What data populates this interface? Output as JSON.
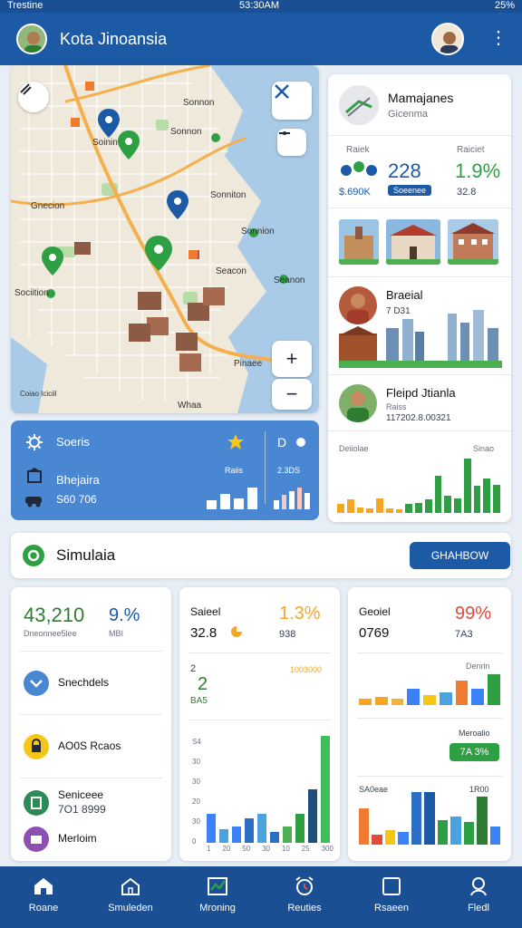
{
  "status": {
    "left": "Trestine",
    "time": "53:30AM",
    "battery": "25%"
  },
  "header": {
    "title": "Kota Jinoansia"
  },
  "map": {
    "labels": [
      "Soinin",
      "Sonnon",
      "Gnecion",
      "Sonnon",
      "Sonniton",
      "Sonnion",
      "Seacon",
      "Seanon",
      "Sociition",
      "Coiao Iciciil",
      "Pinaee",
      "Whaa"
    ],
    "zoom_in": "+",
    "zoom_out": "−"
  },
  "right_panel": {
    "profile": {
      "name": "Mamajanes",
      "subtitle": "Gicenma"
    },
    "stats": {
      "label_left": "Raiek",
      "label_right": "Raiciet",
      "value_main": "228",
      "value_pct": "1.9%",
      "sub_left": "$.690K",
      "badge": "Soeenee",
      "sub_right": "32.8"
    },
    "agent1": {
      "name": "Braeial",
      "sub": "7 D31"
    },
    "agent2": {
      "name": "Fleipd Jtianla",
      "sub1": "Raiss",
      "sub2": "117202.8.00321"
    },
    "chart": {
      "label_left": "Deiiolae",
      "label_right": "Sinao",
      "values": [
        14,
        22,
        9,
        7,
        24,
        8,
        6,
        14,
        16,
        22,
        60,
        28,
        24,
        88,
        44,
        56,
        46
      ]
    }
  },
  "blue_panel": {
    "row1_label": "Soeris",
    "row2_label": "Bhejaira",
    "row3_label": "S60 706",
    "right_top": "Raiis",
    "right_top2": "2.3DS",
    "bars_left": [
      8,
      14,
      10,
      20
    ],
    "bars_right": [
      10,
      16,
      20,
      24,
      18
    ]
  },
  "simulation": {
    "title": "Simulaia",
    "button": "GHAHBOW"
  },
  "card1": {
    "value": "43,210",
    "pct": "9.%",
    "sub_left": "Dneonnee5lee",
    "sub_right": "MBI",
    "items": [
      "Snechdels",
      "AO0S Rcaos",
      "Seniceee",
      "Merloim"
    ],
    "item3_sub": "7O1 8999"
  },
  "card2": {
    "label": "Saieel",
    "pct": "1.3%",
    "value": "32.8",
    "sub": "938",
    "mini_top": "2",
    "mini_num": "2",
    "mini_sub": "BA5",
    "mini_right": "1003000",
    "y_ticks": [
      "S4",
      "30",
      "30",
      "20",
      "30",
      "0"
    ],
    "x_ticks": [
      "1",
      "20",
      "50",
      "30",
      "10",
      "25",
      "300"
    ],
    "bars": [
      22,
      10,
      12,
      18,
      22,
      8,
      12,
      22,
      40,
      80
    ]
  },
  "card3": {
    "label": "Geoiel",
    "pct": "99%",
    "value": "0769",
    "sub": "7A3",
    "chart1_label": "Denrin",
    "chart1": [
      3,
      4,
      3,
      8,
      5,
      6,
      12,
      8,
      15
    ],
    "badge_label": "Meroalio",
    "badge": "7A 3%",
    "chart2_label_left": "SA0eae",
    "chart2_label_right": "1R00",
    "chart2": [
      44,
      12,
      18,
      16,
      64,
      64,
      30,
      34,
      28,
      58,
      22
    ]
  },
  "nav": [
    "Roane",
    "Smuleden",
    "Mroning",
    "Reuties",
    "Rsaeen",
    "Fledl"
  ],
  "colors": {
    "primary": "#1d5aa6",
    "green": "#2ea043",
    "orange": "#f5a623",
    "red": "#e04b3b",
    "blue": "#3b82f6"
  }
}
